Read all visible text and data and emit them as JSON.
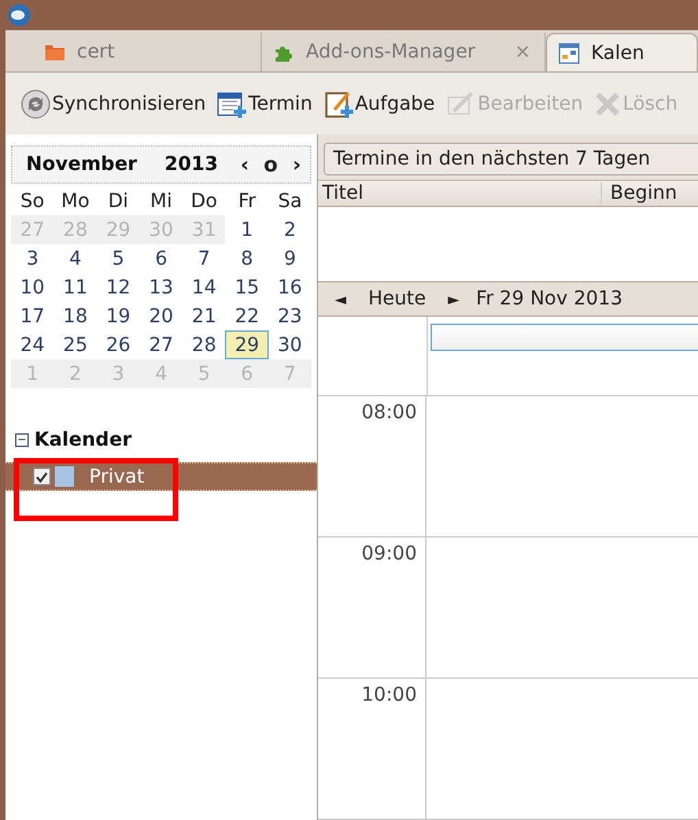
{
  "tabs": [
    {
      "label": "cert",
      "kind": "folder",
      "selected": false
    },
    {
      "label": "Add-ons-Manager",
      "kind": "puzzle",
      "selected": false,
      "close": "×"
    },
    {
      "label": "Kalen",
      "kind": "calendar",
      "selected": true
    }
  ],
  "toolbar": [
    {
      "label": "Synchronisieren",
      "kind": "sync",
      "disabled": false
    },
    {
      "label": "Termin",
      "kind": "event",
      "disabled": false
    },
    {
      "label": "Aufgabe",
      "kind": "task",
      "disabled": false
    },
    {
      "label": "Bearbeiten",
      "kind": "edit",
      "disabled": true
    },
    {
      "label": "Lösch",
      "kind": "delete",
      "disabled": true
    }
  ],
  "minimonth": {
    "month": "November",
    "year": "2013",
    "prev": "‹",
    "today": "o",
    "next": "›",
    "weekdays": [
      "So",
      "Mo",
      "Di",
      "Mi",
      "Do",
      "Fr",
      "Sa"
    ],
    "weeks": [
      [
        {
          "day": "27",
          "outside": true,
          "selected": false
        },
        {
          "day": "28",
          "outside": true,
          "selected": false
        },
        {
          "day": "29",
          "outside": true,
          "selected": false
        },
        {
          "day": "30",
          "outside": true,
          "selected": false
        },
        {
          "day": "31",
          "outside": true,
          "selected": false
        },
        {
          "day": "1",
          "outside": false,
          "selected": false
        },
        {
          "day": "2",
          "outside": false,
          "selected": false
        }
      ],
      [
        {
          "day": "3",
          "outside": false,
          "selected": false
        },
        {
          "day": "4",
          "outside": false,
          "selected": false
        },
        {
          "day": "5",
          "outside": false,
          "selected": false
        },
        {
          "day": "6",
          "outside": false,
          "selected": false
        },
        {
          "day": "7",
          "outside": false,
          "selected": false
        },
        {
          "day": "8",
          "outside": false,
          "selected": false
        },
        {
          "day": "9",
          "outside": false,
          "selected": false
        }
      ],
      [
        {
          "day": "10",
          "outside": false,
          "selected": false
        },
        {
          "day": "11",
          "outside": false,
          "selected": false
        },
        {
          "day": "12",
          "outside": false,
          "selected": false
        },
        {
          "day": "13",
          "outside": false,
          "selected": false
        },
        {
          "day": "14",
          "outside": false,
          "selected": false
        },
        {
          "day": "15",
          "outside": false,
          "selected": false
        },
        {
          "day": "16",
          "outside": false,
          "selected": false
        }
      ],
      [
        {
          "day": "17",
          "outside": false,
          "selected": false
        },
        {
          "day": "18",
          "outside": false,
          "selected": false
        },
        {
          "day": "19",
          "outside": false,
          "selected": false
        },
        {
          "day": "20",
          "outside": false,
          "selected": false
        },
        {
          "day": "21",
          "outside": false,
          "selected": false
        },
        {
          "day": "22",
          "outside": false,
          "selected": false
        },
        {
          "day": "23",
          "outside": false,
          "selected": false
        }
      ],
      [
        {
          "day": "24",
          "outside": false,
          "selected": false
        },
        {
          "day": "25",
          "outside": false,
          "selected": false
        },
        {
          "day": "26",
          "outside": false,
          "selected": false
        },
        {
          "day": "27",
          "outside": false,
          "selected": false
        },
        {
          "day": "28",
          "outside": false,
          "selected": false
        },
        {
          "day": "29",
          "outside": false,
          "selected": true
        },
        {
          "day": "30",
          "outside": false,
          "selected": false
        }
      ],
      [
        {
          "day": "1",
          "outside": true,
          "selected": false
        },
        {
          "day": "2",
          "outside": true,
          "selected": false
        },
        {
          "day": "3",
          "outside": true,
          "selected": false
        },
        {
          "day": "4",
          "outside": true,
          "selected": false
        },
        {
          "day": "5",
          "outside": true,
          "selected": false
        },
        {
          "day": "6",
          "outside": true,
          "selected": false
        },
        {
          "day": "7",
          "outside": true,
          "selected": false
        }
      ]
    ]
  },
  "calendars": {
    "title": "Kalender",
    "expanded": true,
    "toggle": "−",
    "items": [
      {
        "name": "Privat",
        "checked": true,
        "selected": true,
        "color": "#a9c4e3"
      }
    ]
  },
  "agenda": {
    "filter": "Termine in den nächsten 7 Tagen",
    "columns": [
      "Titel",
      "Beginn"
    ]
  },
  "day_view": {
    "prev": "◄",
    "today": "Heute",
    "next": "►",
    "date": "Fr 29 Nov 2013",
    "hours": [
      "08:00",
      "09:00",
      "10:00"
    ]
  }
}
